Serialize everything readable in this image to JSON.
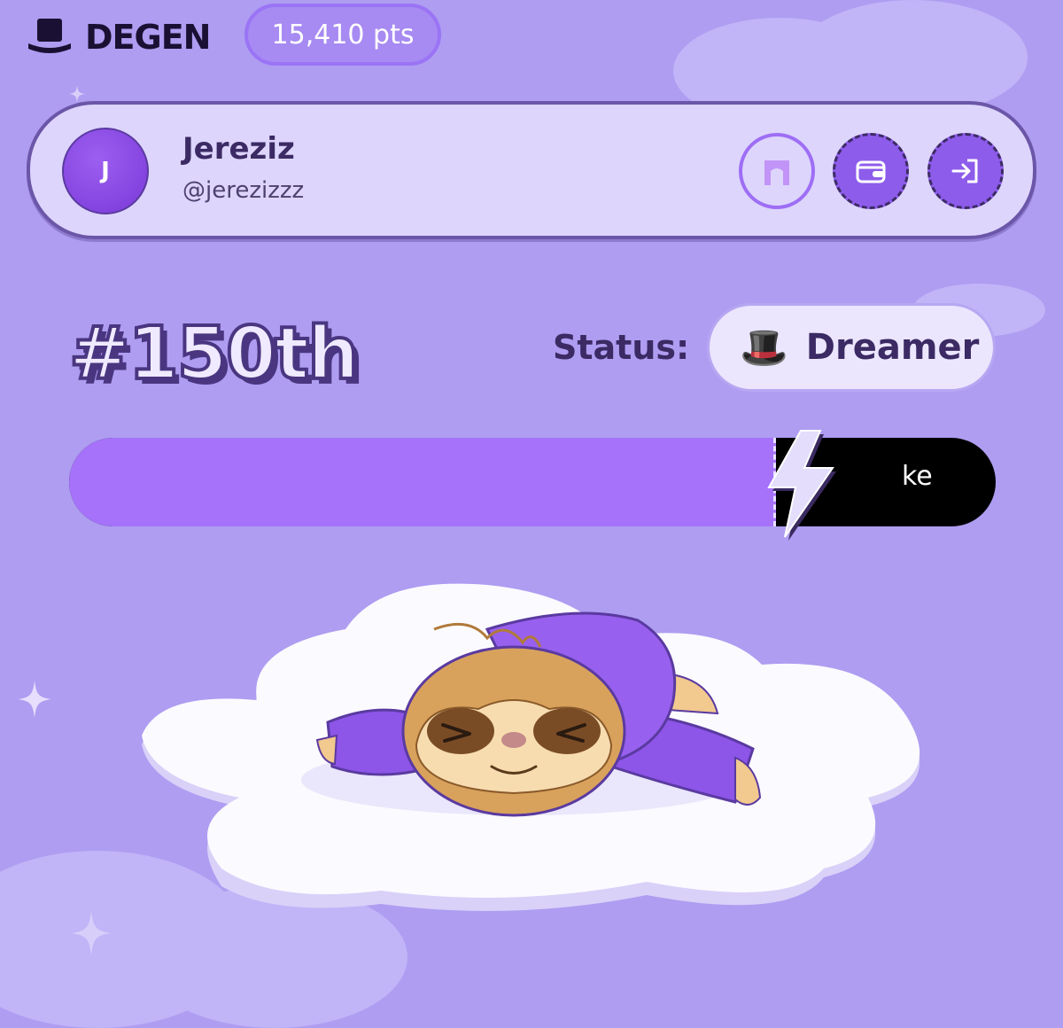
{
  "header": {
    "logo_icon": "top-hat-icon",
    "logo_text": "DEGEN",
    "points": "15,410 pts"
  },
  "profile": {
    "avatar_initial": "J",
    "name": "Jereziz",
    "handle": "@jerezizzz",
    "buttons": [
      {
        "icon": "gate-icon"
      },
      {
        "icon": "wallet-icon"
      },
      {
        "icon": "logout-icon"
      }
    ]
  },
  "rank": "#150th",
  "status": {
    "label": "Status:",
    "emoji": "🎩",
    "name": "Dreamer"
  },
  "progress": {
    "fraction": 0.76,
    "visible_text": "ke",
    "icon": "lightning-bolt-icon"
  },
  "illustration": "sleeping-sloth-on-cloud",
  "colors": {
    "background": "#ae9df1",
    "accent": "#a672fa",
    "text_dark": "#3b2a63"
  }
}
